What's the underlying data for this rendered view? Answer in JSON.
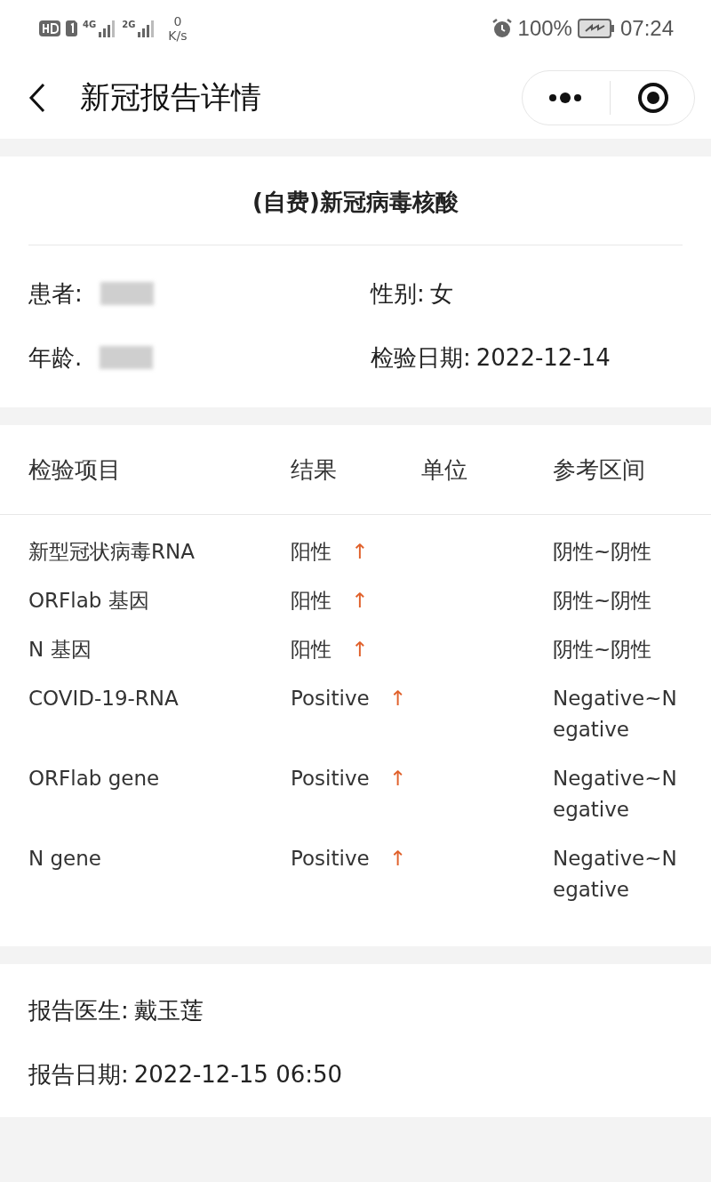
{
  "status_bar": {
    "network_labels": [
      "4G",
      "2G"
    ],
    "speed_value": "0",
    "speed_unit": "K/s",
    "battery": "100%",
    "time": "07:24"
  },
  "nav": {
    "title": "新冠报告详情"
  },
  "report": {
    "title": "(自费)新冠病毒核酸",
    "fields": [
      {
        "label": "患者:",
        "value_redacted": true
      },
      {
        "label": "性别:",
        "value": "女"
      },
      {
        "label": "年龄.",
        "value_redacted": true
      },
      {
        "label": "检验日期:",
        "value": "2022-12-14"
      }
    ]
  },
  "table": {
    "columns": [
      "检验项目",
      "结果",
      "单位",
      "参考区间"
    ],
    "rows": [
      {
        "item": "新型冠状病毒RNA",
        "result": "阳性",
        "flag": "↑",
        "reference": "阴性~阴性"
      },
      {
        "item": "ORFlab 基因",
        "result": "阳性",
        "flag": "↑",
        "reference": "阴性~阴性"
      },
      {
        "item": "N 基因",
        "result": "阳性",
        "flag": "↑",
        "reference": "阴性~阴性"
      },
      {
        "item": "COVID-19-RNA",
        "result": "Positive",
        "flag": "↑",
        "reference": "Negative~Negative"
      },
      {
        "item": "ORFlab gene",
        "result": "Positive",
        "flag": "↑",
        "reference": "Negative~Negative"
      },
      {
        "item": "N gene",
        "result": "Positive",
        "flag": "↑",
        "reference": "Negative~Negative"
      }
    ]
  },
  "footer": {
    "fields": [
      {
        "label": "报告医生:",
        "value": "戴玉莲"
      },
      {
        "label": "报告日期:",
        "value": "2022-12-15 06:50"
      }
    ]
  }
}
